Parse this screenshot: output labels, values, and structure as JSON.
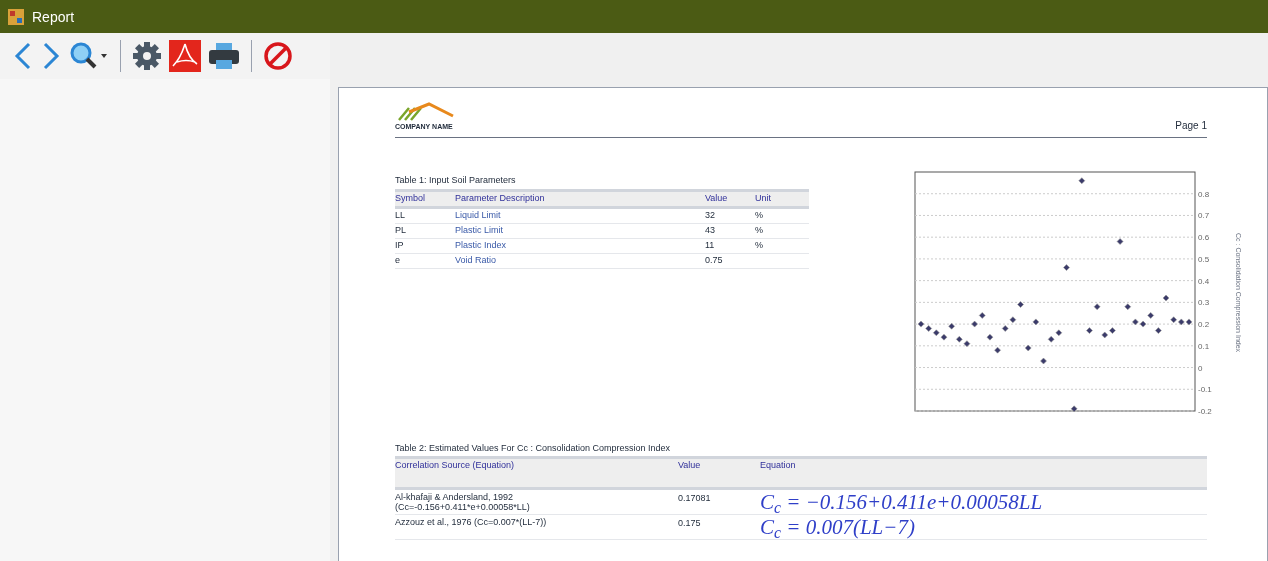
{
  "window": {
    "title": "Report"
  },
  "toolbar": {
    "buttons": [
      {
        "kind": "back"
      },
      {
        "kind": "forward"
      },
      {
        "kind": "zoom"
      },
      {
        "kind": "separator"
      },
      {
        "kind": "settings"
      },
      {
        "kind": "pdf"
      },
      {
        "kind": "print"
      },
      {
        "kind": "separator"
      },
      {
        "kind": "stop"
      }
    ]
  },
  "report": {
    "logo": {
      "name": "COMPANY NAME"
    },
    "page_label": "Page 1",
    "table_1": {
      "title": "Table 1: Input Soil Parameters",
      "columns": [
        "Symbol",
        "Parameter Description",
        "Value",
        "Unit"
      ],
      "rows": [
        [
          "LL",
          "Liquid Limit",
          "32",
          "%"
        ],
        [
          "PL",
          "Plastic Limit",
          "43",
          "%"
        ],
        [
          "IP",
          "Plastic Index",
          "11",
          "%"
        ],
        [
          "e",
          "Void Ratio",
          "0.75",
          ""
        ]
      ]
    },
    "chart": {
      "chart_data": {
        "type": "scatter",
        "ylabel": "Cc : Consolidation Compression Index",
        "grid": true,
        "ylim": [
          -0.2,
          0.9
        ],
        "yticks": [
          -0.2,
          -0.1,
          0,
          0.1,
          0.2,
          0.3,
          0.4,
          0.5,
          0.6,
          0.7,
          0.8
        ],
        "series": [
          {
            "color": "#3b3b6b",
            "values": [
              0.2,
              0.18,
              0.16,
              0.14,
              0.19,
              0.13,
              0.11,
              0.2,
              0.24,
              0.14,
              0.08,
              0.18,
              0.22,
              0.29,
              0.09,
              0.21,
              0.03,
              0.13,
              0.16,
              0.46,
              -0.19,
              0.86,
              0.17,
              0.28,
              0.15,
              0.17,
              0.58,
              0.28,
              0.21,
              0.2,
              0.24,
              0.17,
              0.32,
              0.22,
              0.21,
              0.21
            ]
          }
        ]
      }
    },
    "table_2": {
      "title": "Table 2: Estimated Values For Cc : Consolidation Compression Index",
      "columns": [
        "Correlation Source (Equation)",
        "Value",
        "Equation"
      ],
      "rows": [
        {
          "source": "Al-khafaji & Andersland, 1992 (Cc=-0.156+0.411*e+0.00058*LL)",
          "value": "0.17081",
          "equation": "C$_{c}$ = −0.156+0.411e+0.00058LL"
        },
        {
          "source": "Azzouz et al., 1976 (Cc=0.007*(LL-7))",
          "value": "0.175",
          "equation": "C$_{c}$ = 0.007(LL−7)"
        }
      ]
    }
  }
}
